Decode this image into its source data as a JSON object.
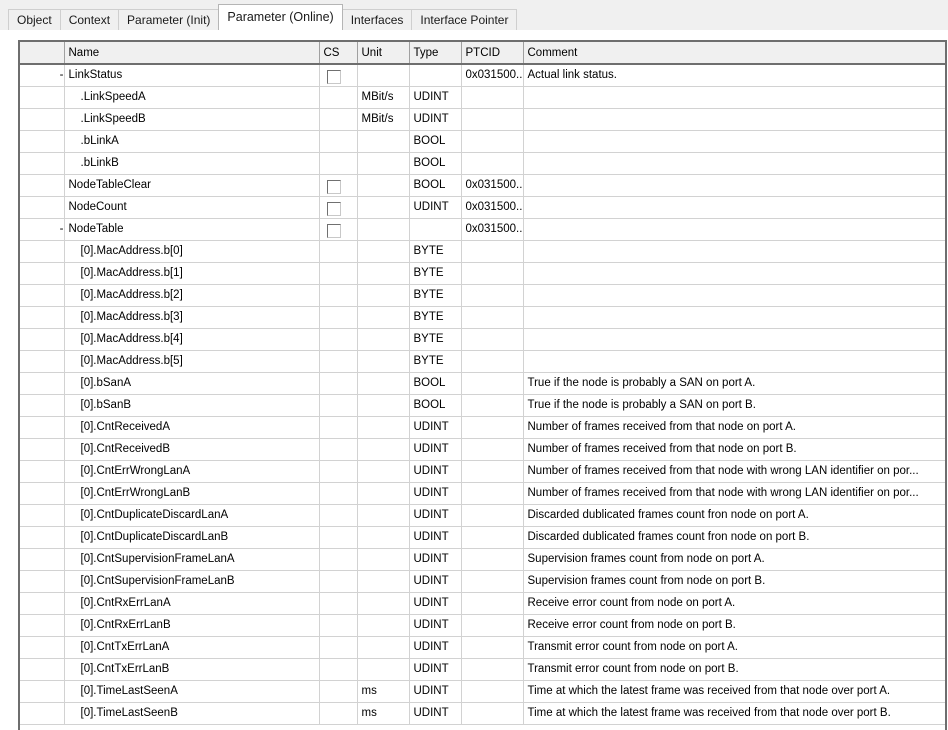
{
  "window": {
    "tabs": [
      {
        "label": "Object",
        "selected": false
      },
      {
        "label": "Context",
        "selected": false
      },
      {
        "label": "Parameter (Init)",
        "selected": false
      },
      {
        "label": "Parameter (Online)",
        "selected": true
      },
      {
        "label": "Interfaces",
        "selected": false
      },
      {
        "label": "Interface Pointer",
        "selected": false
      }
    ]
  },
  "grid": {
    "columns": [
      {
        "key": "rowhdr",
        "label": ""
      },
      {
        "key": "name",
        "label": "Name"
      },
      {
        "key": "cs",
        "label": "CS"
      },
      {
        "key": "unit",
        "label": "Unit"
      },
      {
        "key": "type",
        "label": "Type"
      },
      {
        "key": "ptcid",
        "label": "PTCID"
      },
      {
        "key": "comment",
        "label": "Comment"
      }
    ],
    "rows": [
      {
        "marker": "-",
        "current": true,
        "indent": 0,
        "name": "LinkStatus",
        "checkbox": true,
        "unit": "",
        "type": "",
        "ptcid": "0x031500...",
        "comment": "Actual link status.",
        "shaded": false
      },
      {
        "marker": "",
        "current": false,
        "indent": 1,
        "name": ".LinkSpeedA",
        "checkbox": false,
        "unit": "MBit/s",
        "type": "UDINT",
        "ptcid": "",
        "comment": "",
        "shaded": true
      },
      {
        "marker": "",
        "current": false,
        "indent": 1,
        "name": ".LinkSpeedB",
        "checkbox": false,
        "unit": "MBit/s",
        "type": "UDINT",
        "ptcid": "",
        "comment": "",
        "shaded": true
      },
      {
        "marker": "",
        "current": false,
        "indent": 1,
        "name": ".bLinkA",
        "checkbox": false,
        "unit": "",
        "type": "BOOL",
        "ptcid": "",
        "comment": "",
        "shaded": true
      },
      {
        "marker": "",
        "current": false,
        "indent": 1,
        "name": ".bLinkB",
        "checkbox": false,
        "unit": "",
        "type": "BOOL",
        "ptcid": "",
        "comment": "",
        "shaded": true
      },
      {
        "marker": "",
        "current": false,
        "indent": 0,
        "name": "NodeTableClear",
        "checkbox": true,
        "unit": "",
        "type": "BOOL",
        "ptcid": "0x031500...",
        "comment": "",
        "shaded": false
      },
      {
        "marker": "",
        "current": false,
        "indent": 0,
        "name": "NodeCount",
        "checkbox": true,
        "unit": "",
        "type": "UDINT",
        "ptcid": "0x031500...",
        "comment": "",
        "shaded": false
      },
      {
        "marker": "-",
        "current": false,
        "indent": 0,
        "name": "NodeTable",
        "checkbox": true,
        "unit": "",
        "type": "",
        "ptcid": "0x031500...",
        "comment": "",
        "shaded": true
      },
      {
        "marker": "",
        "current": false,
        "indent": 1,
        "name": "[0].MacAddress.b[0]",
        "checkbox": false,
        "unit": "",
        "type": "BYTE",
        "ptcid": "",
        "comment": "",
        "shaded": true
      },
      {
        "marker": "",
        "current": false,
        "indent": 1,
        "name": "[0].MacAddress.b[1]",
        "checkbox": false,
        "unit": "",
        "type": "BYTE",
        "ptcid": "",
        "comment": "",
        "shaded": true
      },
      {
        "marker": "",
        "current": false,
        "indent": 1,
        "name": "[0].MacAddress.b[2]",
        "checkbox": false,
        "unit": "",
        "type": "BYTE",
        "ptcid": "",
        "comment": "",
        "shaded": true
      },
      {
        "marker": "",
        "current": false,
        "indent": 1,
        "name": "[0].MacAddress.b[3]",
        "checkbox": false,
        "unit": "",
        "type": "BYTE",
        "ptcid": "",
        "comment": "",
        "shaded": true
      },
      {
        "marker": "",
        "current": false,
        "indent": 1,
        "name": "[0].MacAddress.b[4]",
        "checkbox": false,
        "unit": "",
        "type": "BYTE",
        "ptcid": "",
        "comment": "",
        "shaded": true
      },
      {
        "marker": "",
        "current": false,
        "indent": 1,
        "name": "[0].MacAddress.b[5]",
        "checkbox": false,
        "unit": "",
        "type": "BYTE",
        "ptcid": "",
        "comment": "",
        "shaded": true
      },
      {
        "marker": "",
        "current": false,
        "indent": 1,
        "name": "[0].bSanA",
        "checkbox": false,
        "unit": "",
        "type": "BOOL",
        "ptcid": "",
        "comment": "True if the node is probably a SAN on port A.",
        "shaded": true
      },
      {
        "marker": "",
        "current": false,
        "indent": 1,
        "name": "[0].bSanB",
        "checkbox": false,
        "unit": "",
        "type": "BOOL",
        "ptcid": "",
        "comment": "True if the node is probably a SAN on port B.",
        "shaded": true
      },
      {
        "marker": "",
        "current": false,
        "indent": 1,
        "name": "[0].CntReceivedA",
        "checkbox": false,
        "unit": "",
        "type": "UDINT",
        "ptcid": "",
        "comment": "Number of frames received from that node on port A.",
        "shaded": true
      },
      {
        "marker": "",
        "current": false,
        "indent": 1,
        "name": "[0].CntReceivedB",
        "checkbox": false,
        "unit": "",
        "type": "UDINT",
        "ptcid": "",
        "comment": "Number of frames received from that node on port B.",
        "shaded": true
      },
      {
        "marker": "",
        "current": false,
        "indent": 1,
        "name": "[0].CntErrWrongLanA",
        "checkbox": false,
        "unit": "",
        "type": "UDINT",
        "ptcid": "",
        "comment": "Number of frames received from that node with wrong LAN identifier on por...",
        "shaded": true
      },
      {
        "marker": "",
        "current": false,
        "indent": 1,
        "name": "[0].CntErrWrongLanB",
        "checkbox": false,
        "unit": "",
        "type": "UDINT",
        "ptcid": "",
        "comment": "Number of frames received from that node with wrong LAN identifier on por...",
        "shaded": true
      },
      {
        "marker": "",
        "current": false,
        "indent": 1,
        "name": "[0].CntDuplicateDiscardLanA",
        "checkbox": false,
        "unit": "",
        "type": "UDINT",
        "ptcid": "",
        "comment": "Discarded dublicated frames count fron node on port A.",
        "shaded": true
      },
      {
        "marker": "",
        "current": false,
        "indent": 1,
        "name": "[0].CntDuplicateDiscardLanB",
        "checkbox": false,
        "unit": "",
        "type": "UDINT",
        "ptcid": "",
        "comment": "Discarded dublicated frames count fron node on port B.",
        "shaded": true
      },
      {
        "marker": "",
        "current": false,
        "indent": 1,
        "name": "[0].CntSupervisionFrameLanA",
        "checkbox": false,
        "unit": "",
        "type": "UDINT",
        "ptcid": "",
        "comment": "Supervision frames count from node on port A.",
        "shaded": true
      },
      {
        "marker": "",
        "current": false,
        "indent": 1,
        "name": "[0].CntSupervisionFrameLanB",
        "checkbox": false,
        "unit": "",
        "type": "UDINT",
        "ptcid": "",
        "comment": "Supervision frames count from node on port B.",
        "shaded": true
      },
      {
        "marker": "",
        "current": false,
        "indent": 1,
        "name": "[0].CntRxErrLanA",
        "checkbox": false,
        "unit": "",
        "type": "UDINT",
        "ptcid": "",
        "comment": "Receive error count from node on port A.",
        "shaded": true
      },
      {
        "marker": "",
        "current": false,
        "indent": 1,
        "name": "[0].CntRxErrLanB",
        "checkbox": false,
        "unit": "",
        "type": "UDINT",
        "ptcid": "",
        "comment": "Receive error count from node on port B.",
        "shaded": true
      },
      {
        "marker": "",
        "current": false,
        "indent": 1,
        "name": "[0].CntTxErrLanA",
        "checkbox": false,
        "unit": "",
        "type": "UDINT",
        "ptcid": "",
        "comment": "Transmit error count from node on port A.",
        "shaded": true
      },
      {
        "marker": "",
        "current": false,
        "indent": 1,
        "name": "[0].CntTxErrLanB",
        "checkbox": false,
        "unit": "",
        "type": "UDINT",
        "ptcid": "",
        "comment": "Transmit error count from node on port B.",
        "shaded": true
      },
      {
        "marker": "",
        "current": false,
        "indent": 1,
        "name": "[0].TimeLastSeenA",
        "checkbox": false,
        "unit": "ms",
        "type": "UDINT",
        "ptcid": "",
        "comment": "Time at which the latest frame was received from that node over port A.",
        "shaded": true
      },
      {
        "marker": "",
        "current": false,
        "indent": 1,
        "name": "[0].TimeLastSeenB",
        "checkbox": false,
        "unit": "ms",
        "type": "UDINT",
        "ptcid": "",
        "comment": "Time at which the latest frame was received from that node over port B.",
        "shaded": true
      }
    ]
  },
  "colors": {
    "header_bg": "#f0f0f0",
    "grid_border": "#6e6e6e",
    "cell_border": "#d2d2d2",
    "shaded_cell": "#efefef",
    "selected_tab_bg": "#ffffff"
  }
}
